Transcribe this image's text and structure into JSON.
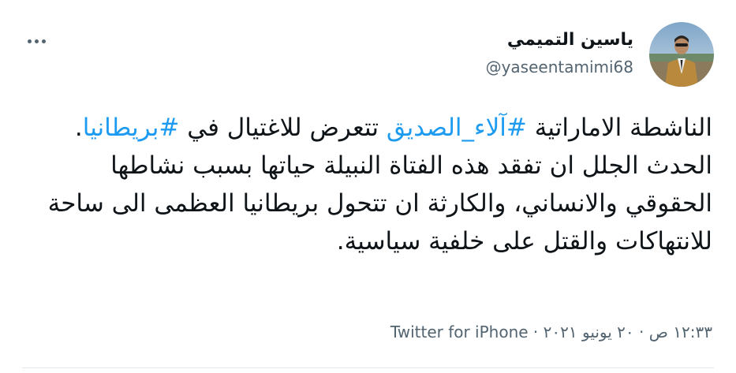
{
  "author": {
    "display_name": "ياسين التميمي",
    "handle": "@yaseentamimi68"
  },
  "menu": {
    "icon": "more-horizontal-icon"
  },
  "tweet": {
    "segments": [
      {
        "text": "الناشطة الاماراتية ",
        "hashtag": false
      },
      {
        "text": "#آلاء_الصديق",
        "hashtag": true
      },
      {
        "text": " تتعرض للاغتيال في ",
        "hashtag": false
      },
      {
        "text": "#بريطانيا",
        "hashtag": true
      },
      {
        "text": ". الحدث الجلل ان تفقد هذه الفتاة النبيلة حياتها بسبب نشاطها الحقوقي والانساني، والكارثة ان تتحول بريطانيا العظمى الى ساحة للانتهاكات والقتل على خلفية سياسية.",
        "hashtag": false
      }
    ]
  },
  "meta": {
    "time": "١٢:٣٣ ص",
    "separator1": " · ",
    "date": "٢٠ يونيو ٢٠٢١",
    "separator2": " · ",
    "source": "Twitter for iPhone"
  },
  "colors": {
    "hashtag": "#1d9bf0",
    "secondary_text": "#536471",
    "primary_text": "#0f1419"
  }
}
